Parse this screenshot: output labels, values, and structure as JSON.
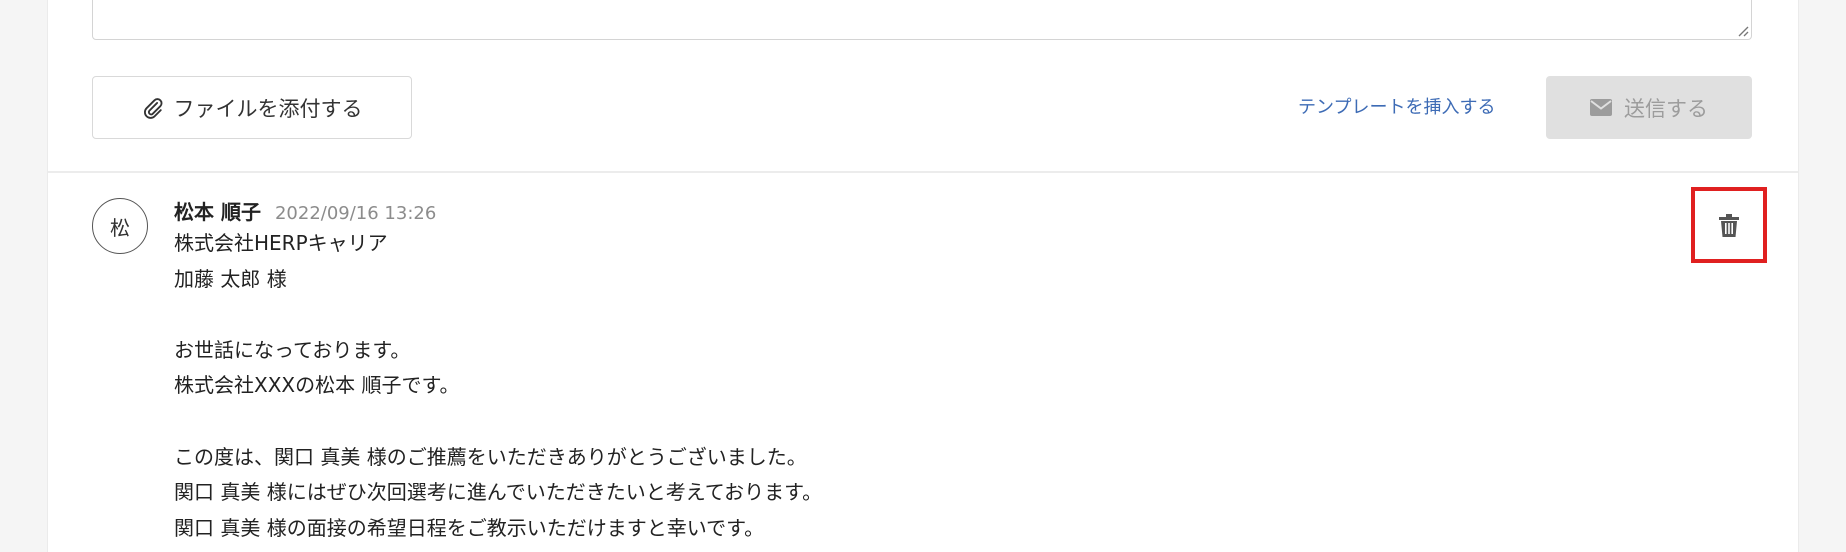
{
  "composer": {
    "attach_label": "ファイルを添付する",
    "template_link": "テンプレートを挿入する",
    "send_label": "送信する"
  },
  "comment": {
    "avatar_initial": "松",
    "author": "松本 順子",
    "timestamp": "2022/09/16 13:26",
    "lines": [
      "株式会社HERPキャリア",
      "加藤 太郎 様",
      "",
      "お世話になっております。",
      "株式会社XXXの松本 順子です。",
      "",
      "この度は、関口 真美 様のご推薦をいただきありがとうございました。",
      "関口 真美 様にはぜひ次回選考に進んでいただきたいと考えております。",
      "関口 真美 様の面接の希望日程をご教示いただけますと幸いです。"
    ]
  },
  "colors": {
    "link": "#3d6bb5",
    "highlight": "#e02020",
    "send_disabled_bg": "#e0e0e0"
  },
  "icons": [
    "paperclip-icon",
    "envelope-icon",
    "trash-icon",
    "resize-handle-icon"
  ]
}
